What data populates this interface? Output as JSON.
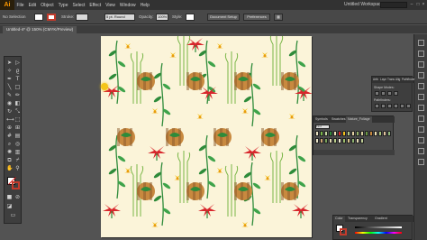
{
  "app": {
    "logo": "Ai",
    "workspace": "Untitled Workspace 1"
  },
  "menu": [
    "File",
    "Edit",
    "Object",
    "Type",
    "Select",
    "Effect",
    "View",
    "Window",
    "Help"
  ],
  "control_bar": {
    "selection": "No Selection",
    "stroke_label": "Stroke:",
    "brush": "5 pt. Round",
    "opacity_label": "Opacity:",
    "opacity_value": "100%",
    "style_label": "Style:",
    "document_setup": "Document Setup",
    "preferences": "Preferences"
  },
  "doc_tab": {
    "title": "Untitled-4* @ 150% (CMYK/Preview)"
  },
  "panels": {
    "pathfinder": {
      "tabs": [
        "Artb",
        "Laye",
        "Trans",
        "Alig",
        "Pathfinder"
      ],
      "shape_modes_label": "Shape Modes:",
      "pathfinders_label": "Pathfinders:"
    },
    "swatches": {
      "tabs": [
        "Symbols",
        "Swatches",
        "Nature_Foliage"
      ],
      "active_tab": "Nature_Foliage",
      "find_placeholder": "Find"
    },
    "color": {
      "tabs": [
        "Color",
        "Transparency",
        "Gradient"
      ],
      "active_tab": "Color"
    }
  },
  "colors": {
    "artboard_bg": "#fbf4d9",
    "leaf_green": "#2e8b3a",
    "leaf_light": "#7ab648",
    "flower_red": "#d8262c",
    "flower_yellow": "#f6c21b",
    "stripe_orange": "#c8893f",
    "ui_dark": "#323232",
    "ui_panel": "#3e3e3e"
  },
  "icons": {
    "tools": [
      "selection-icon",
      "direct-selection-icon",
      "magic-wand-icon",
      "lasso-icon",
      "pen-icon",
      "type-icon",
      "line-icon",
      "rectangle-icon",
      "paintbrush-icon",
      "pencil-icon",
      "blob-brush-icon",
      "eraser-icon",
      "rotate-icon",
      "scale-icon",
      "width-icon",
      "free-transform-icon",
      "shape-builder-icon",
      "perspective-grid-icon",
      "mesh-icon",
      "gradient-icon",
      "eyedropper-icon",
      "blend-icon",
      "symbol-sprayer-icon",
      "column-graph-icon",
      "artboard-icon",
      "slice-icon",
      "hand-icon",
      "zoom-icon"
    ]
  }
}
